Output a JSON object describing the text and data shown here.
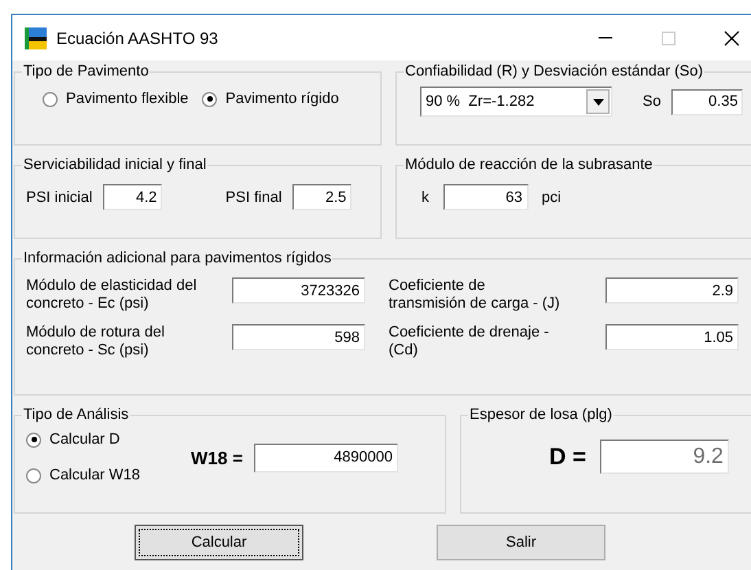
{
  "window": {
    "title": "Ecuación AASHTO 93"
  },
  "tipo_de_pavimento": {
    "title": "Tipo de Pavimento",
    "options": [
      {
        "label": "Pavimento flexible",
        "selected": false
      },
      {
        "label": "Pavimento rígido",
        "selected": true
      }
    ]
  },
  "confiabilidad": {
    "title": "Confiabilidad (R) y Desviación estándar (So)",
    "dropdown": {
      "value": "90 %  Zr=-1.282"
    },
    "so": {
      "label": "So",
      "value": "0.35"
    }
  },
  "serviciabilidad": {
    "title": "Serviciabilidad inicial y final",
    "fields": [
      {
        "label": "PSI inicial",
        "value": "4.2"
      },
      {
        "label": "PSI final",
        "value": "2.5"
      }
    ]
  },
  "modulo_reaccion": {
    "title": "Módulo de reacción de la subrasante",
    "label": "k",
    "value": "63",
    "unit": "pci"
  },
  "informacion_adicional": {
    "title": "Información adicional para pavimentos rígidos",
    "fields": [
      {
        "label": "Módulo de elasticidad del concreto - Ec (psi)",
        "value": "3723326"
      },
      {
        "label": "Coeficiente de transmisión de carga - (J)",
        "value": "2.9"
      },
      {
        "label": "Módulo de rotura del concreto - Sc (psi)",
        "value": "598"
      },
      {
        "label": "Coeficiente de drenaje - (Cd)",
        "value": "1.05"
      }
    ]
  },
  "tipo_de_analisis": {
    "title": "Tipo de Análisis",
    "options": [
      {
        "label": "Calcular D",
        "selected": true
      },
      {
        "label": "Calcular W18",
        "selected": false
      }
    ],
    "w18": {
      "label": "W18 =",
      "value": "4890000"
    }
  },
  "espesor_de_losa": {
    "title": "Espesor de losa (plg)",
    "label": "D =",
    "value": "9.2"
  },
  "buttons": [
    {
      "label": "Calcular",
      "focused": true
    },
    {
      "label": "Salir",
      "focused": false
    }
  ]
}
